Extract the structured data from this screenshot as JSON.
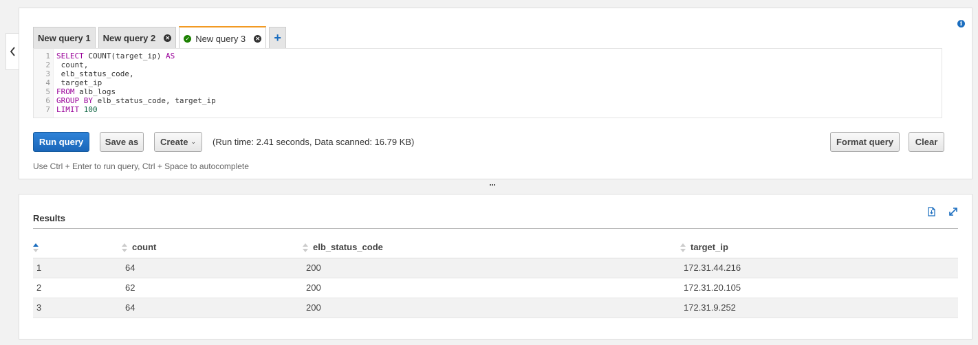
{
  "tabs": [
    {
      "label": "New query 1",
      "closable": false
    },
    {
      "label": "New query 2",
      "closable": true
    },
    {
      "label": "New query 3",
      "closable": true,
      "active": true,
      "status": "success"
    }
  ],
  "add_tab_label": "+",
  "editor": {
    "lines": [
      {
        "n": "1",
        "parts": [
          {
            "t": "SELECT",
            "c": "kw"
          },
          {
            "t": " COUNT(target_ip) "
          },
          {
            "t": "AS",
            "c": "kw"
          }
        ]
      },
      {
        "n": "2",
        "parts": [
          {
            "t": " count,"
          }
        ]
      },
      {
        "n": "3",
        "parts": [
          {
            "t": " elb_status_code,"
          }
        ]
      },
      {
        "n": "4",
        "parts": [
          {
            "t": " target_ip"
          }
        ]
      },
      {
        "n": "5",
        "parts": [
          {
            "t": "FROM",
            "c": "kw"
          },
          {
            "t": " alb_logs"
          }
        ]
      },
      {
        "n": "6",
        "parts": [
          {
            "t": "GROUP BY",
            "c": "kw"
          },
          {
            "t": " elb_status_code, target_ip"
          }
        ]
      },
      {
        "n": "7",
        "parts": [
          {
            "t": "LIMIT",
            "c": "kw"
          },
          {
            "t": " "
          },
          {
            "t": "100",
            "c": "num"
          }
        ]
      }
    ]
  },
  "toolbar": {
    "run_label": "Run query",
    "save_label": "Save as",
    "create_label": "Create",
    "run_info": "(Run time: 2.41 seconds, Data scanned: 16.79 KB)",
    "format_label": "Format query",
    "clear_label": "Clear"
  },
  "hint": "Use Ctrl + Enter to run query, Ctrl + Space to autocomplete",
  "results": {
    "title": "Results",
    "columns": [
      "",
      "count",
      "elb_status_code",
      "target_ip"
    ],
    "rows": [
      [
        "1",
        "64",
        "200",
        "172.31.44.216"
      ],
      [
        "2",
        "62",
        "200",
        "172.31.20.105"
      ],
      [
        "3",
        "64",
        "200",
        "172.31.9.252"
      ]
    ]
  },
  "colors": {
    "primary": "#1a66b9",
    "active_tab_accent": "#f29a23",
    "success": "#1d8102",
    "keyword": "#990099"
  },
  "icons": [
    "chevron-left-icon",
    "info-icon",
    "close-icon",
    "check-circle-icon",
    "plus-icon",
    "caret-down-icon",
    "download-csv-icon",
    "expand-icon",
    "sort-icon"
  ]
}
